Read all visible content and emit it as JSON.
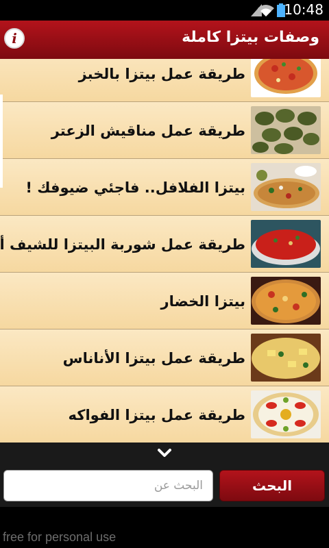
{
  "status_bar": {
    "time": "10:48",
    "icons": [
      "wifi-icon",
      "signal-icon",
      "battery-icon"
    ]
  },
  "app_bar": {
    "title": "وصفات بيتزا كاملة",
    "info_icon": "info-icon",
    "info_glyph": "i"
  },
  "list": {
    "items": [
      {
        "label": "طريقة عمل بيتزا بالخبز",
        "thumb": "pizza-bread-image"
      },
      {
        "label": "طريقة عمل مناقيش الزعتر",
        "thumb": "zaatar-manakish-image"
      },
      {
        "label": "بيتزا الفلافل.. فاجئي ضيوفك !",
        "thumb": "falafel-pizza-image"
      },
      {
        "label": "طريقة عمل شوربة البيتزا للشيف أسامة",
        "thumb": "pizza-soup-image"
      },
      {
        "label": "بيتزا الخضار",
        "thumb": "vegetable-pizza-image"
      },
      {
        "label": "طريقة عمل بيتزا الأناناس",
        "thumb": "pineapple-pizza-image"
      },
      {
        "label": "طريقة عمل بيتزا الفواكه",
        "thumb": "fruit-pizza-image"
      }
    ]
  },
  "scroll_hint": {
    "icon": "chevron-down-icon"
  },
  "search": {
    "placeholder": "البحث عن",
    "value": "",
    "button_label": "البحث"
  },
  "footer": {
    "watermark": "free for personal use"
  },
  "colors": {
    "accent": "#a51018",
    "list_background": "#f9e0ae",
    "bottom_bar": "#1a1a1a"
  }
}
